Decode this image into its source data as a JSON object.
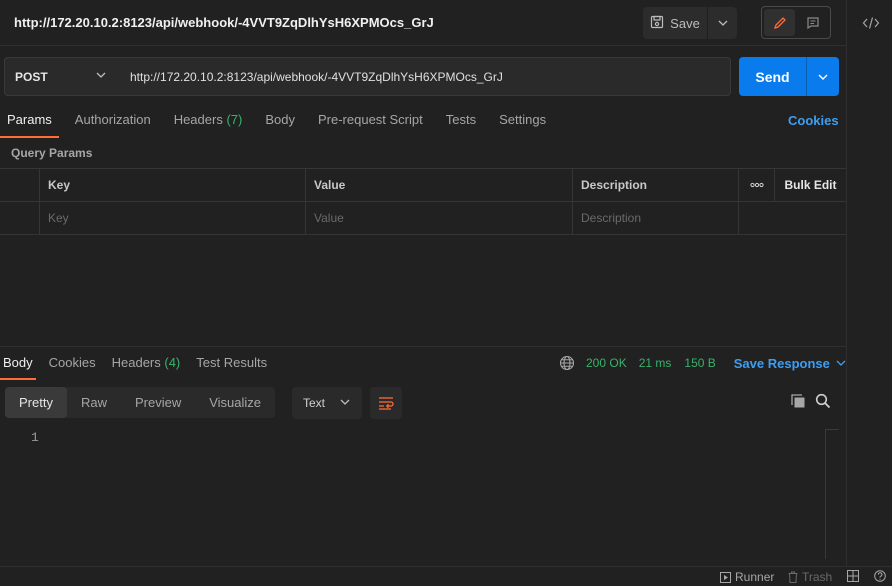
{
  "request": {
    "title": "http://172.20.10.2:8123/api/webhook/-4VVT9ZqDlhYsH6XPMOcs_GrJ",
    "method": "POST",
    "url": "http://172.20.10.2:8123/api/webhook/-4VVT9ZqDlhYsH6XPMOcs_GrJ",
    "save_label": "Save",
    "send_label": "Send"
  },
  "request_tabs": [
    {
      "label": "Params",
      "count": ""
    },
    {
      "label": "Authorization",
      "count": ""
    },
    {
      "label": "Headers",
      "count": "(7)"
    },
    {
      "label": "Body",
      "count": ""
    },
    {
      "label": "Pre-request Script",
      "count": ""
    },
    {
      "label": "Tests",
      "count": ""
    },
    {
      "label": "Settings",
      "count": ""
    }
  ],
  "cookies_label": "Cookies",
  "query_params": {
    "section_label": "Query Params",
    "headers": {
      "key": "Key",
      "value": "Value",
      "description": "Description",
      "more": "°°°",
      "bulk_edit": "Bulk Edit"
    },
    "placeholders": {
      "key": "Key",
      "value": "Value",
      "description": "Description"
    }
  },
  "response": {
    "tabs": [
      {
        "label": "Body",
        "count": ""
      },
      {
        "label": "Cookies",
        "count": ""
      },
      {
        "label": "Headers",
        "count": "(4)"
      },
      {
        "label": "Test Results",
        "count": ""
      }
    ],
    "status": "200 OK",
    "time": "21 ms",
    "size": "150 B",
    "save_response_label": "Save Response",
    "view_modes": [
      "Pretty",
      "Raw",
      "Preview",
      "Visualize"
    ],
    "format": "Text",
    "line_number": "1"
  },
  "statusbar": {
    "runner": "Runner",
    "trash": "Trash"
  },
  "colors": {
    "accent_orange": "#ff6c37",
    "send_blue": "#097bed",
    "link_blue": "#3d9ef2",
    "status_green": "#38b26a"
  }
}
